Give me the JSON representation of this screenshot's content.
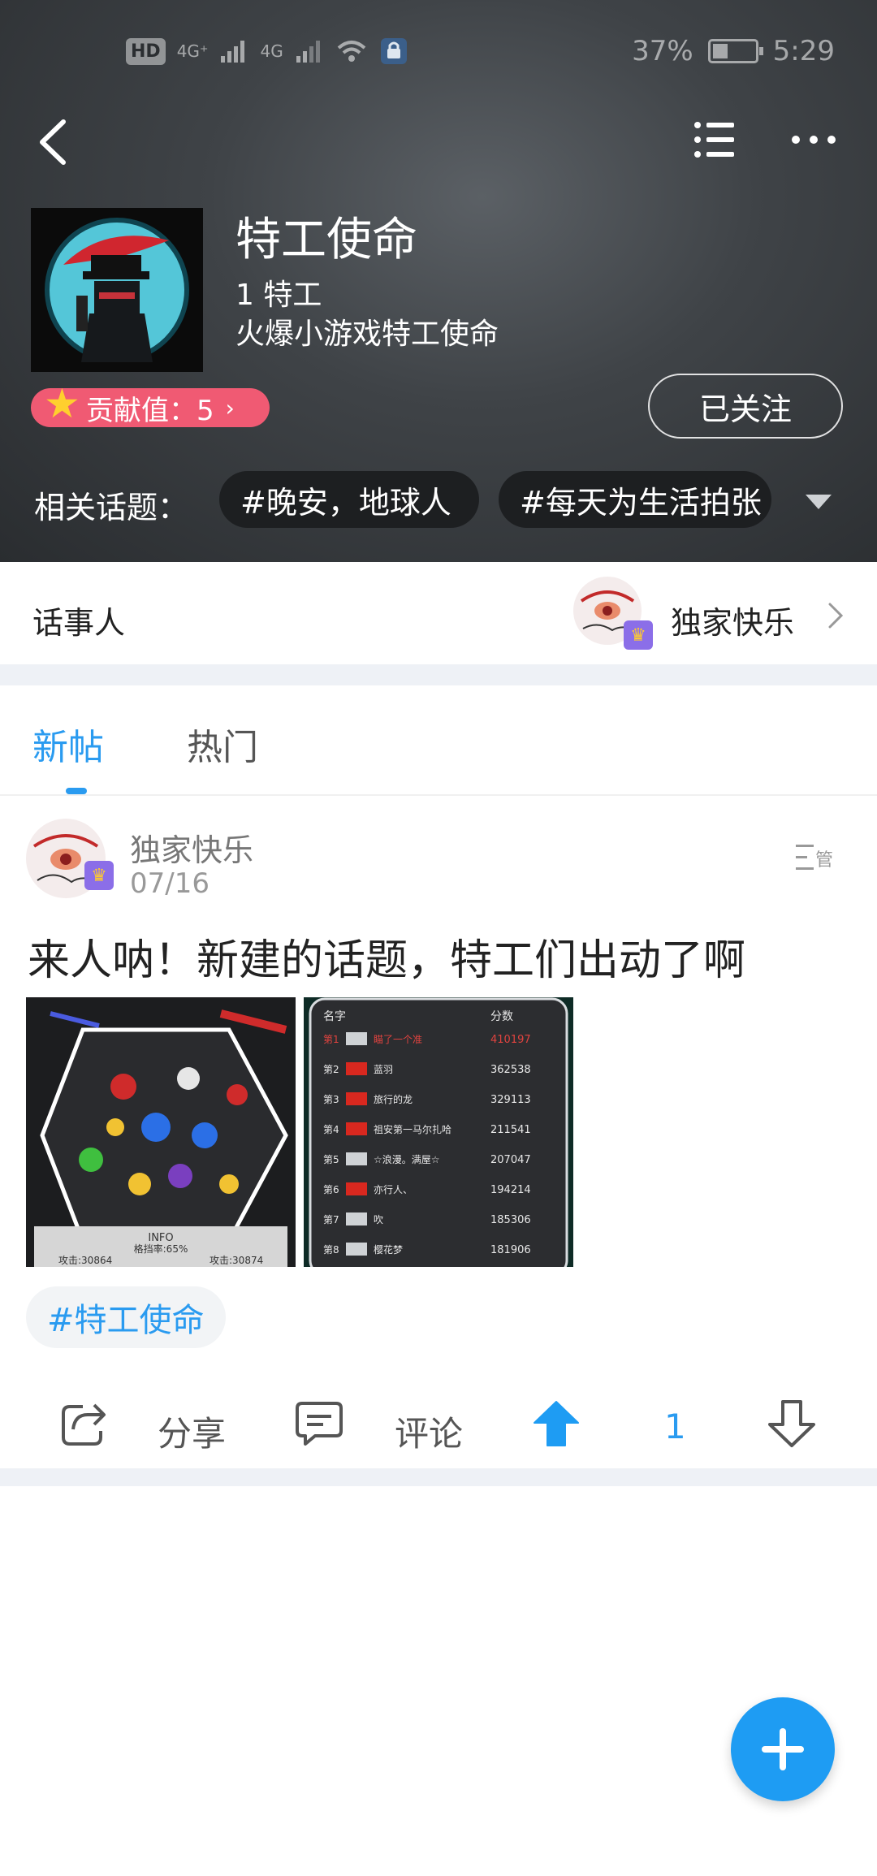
{
  "status_bar": {
    "hd_badge": "HD",
    "signal_1": "4G⁺",
    "signal_2": "4G",
    "battery_percent": "37%",
    "battery_level": 0.37,
    "time": "5:29"
  },
  "topic": {
    "title": "特工使命",
    "member_count": "1 特工",
    "description": "火爆小游戏特工使命",
    "contribution": "贡献值：5",
    "follow_label": "已关注",
    "related_label": "相关话题：",
    "related_topics": [
      "#晚安，地球人",
      "#每天为生活拍张"
    ]
  },
  "host": {
    "label": "话事人",
    "name": "独家快乐"
  },
  "tabs": {
    "new": "新帖",
    "hot": "热门"
  },
  "post": {
    "author": "独家快乐",
    "date": "07/16",
    "text": "来人呐！新建的话题，特工们出动了啊",
    "tag": "#特工使命",
    "leaderboard": {
      "header_name": "名字",
      "header_score": "分数",
      "rows": [
        {
          "rank": "第1",
          "name": "瞄了一个准",
          "score": "410197"
        },
        {
          "rank": "第2",
          "name": "蓝羽",
          "score": "362538"
        },
        {
          "rank": "第3",
          "name": "旅行的龙",
          "score": "329113"
        },
        {
          "rank": "第4",
          "name": "祖安第一马尔扎哈",
          "score": "211541"
        },
        {
          "rank": "第5",
          "name": "☆浪漫。满屋☆",
          "score": "207047"
        },
        {
          "rank": "第6",
          "name": "亦行人、",
          "score": "194214"
        },
        {
          "rank": "第7",
          "name": "吹",
          "score": "185306"
        },
        {
          "rank": "第8",
          "name": "樱花梦",
          "score": "181906"
        }
      ]
    },
    "game_shot": {
      "info_title": "INFO",
      "block_rate": "格挡率:65%",
      "attack_left": "攻击:30864",
      "attack_right": "攻击:30874"
    }
  },
  "actions": {
    "share": "分享",
    "comment": "评论",
    "upvotes": "1"
  },
  "colors": {
    "accent": "#2a9bf0",
    "contribution_pill": "#f05a73",
    "fab": "#1e9cf3"
  }
}
